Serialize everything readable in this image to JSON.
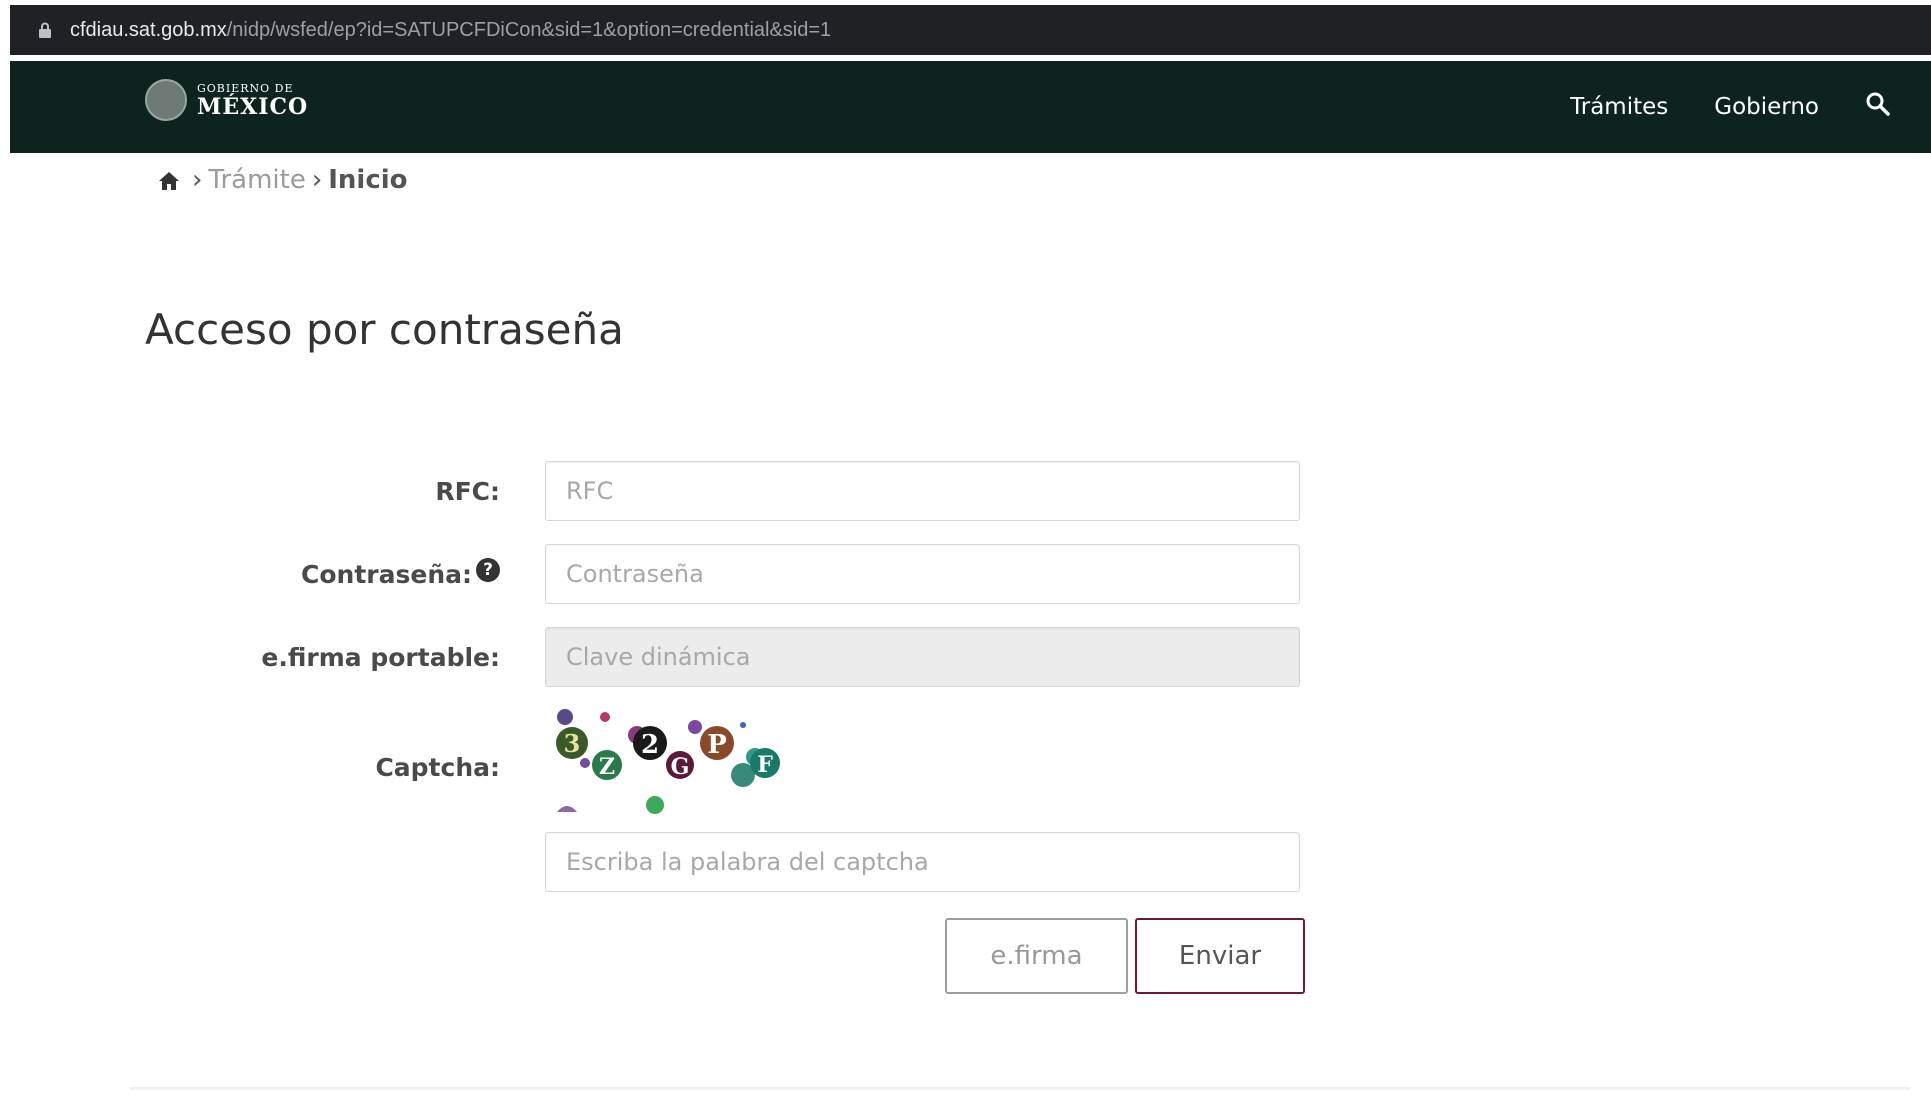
{
  "browser": {
    "url_domain": "cfdiau.sat.gob.mx",
    "url_path": "/nidp/wsfed/ep?id=SATUPCFDiCon&sid=1&option=credential&sid=1"
  },
  "header": {
    "logo_small": "GOBIERNO DE",
    "logo_big": "MÉXICO",
    "nav": [
      "Trámites",
      "Gobierno"
    ],
    "bg_color": "#0c231e"
  },
  "breadcrumb": {
    "trail": "Trámite",
    "current": "Inicio"
  },
  "page_title": "Acceso por contraseña",
  "form": {
    "rfc_label": "RFC:",
    "rfc_placeholder": "RFC",
    "password_label": "Contraseña:",
    "password_placeholder": "Contraseña",
    "efirma_portable_label": "e.firma portable:",
    "efirma_portable_placeholder": "Clave dinámica",
    "captcha_label": "Captcha:",
    "captcha_chars": [
      "3",
      "Z",
      "2",
      "G",
      "P",
      "F"
    ],
    "captcha_placeholder": "Escriba la palabra del captcha",
    "efirma_button": "e.firma",
    "submit_button": "Enviar",
    "submit_border_color": "#6b1a32"
  }
}
